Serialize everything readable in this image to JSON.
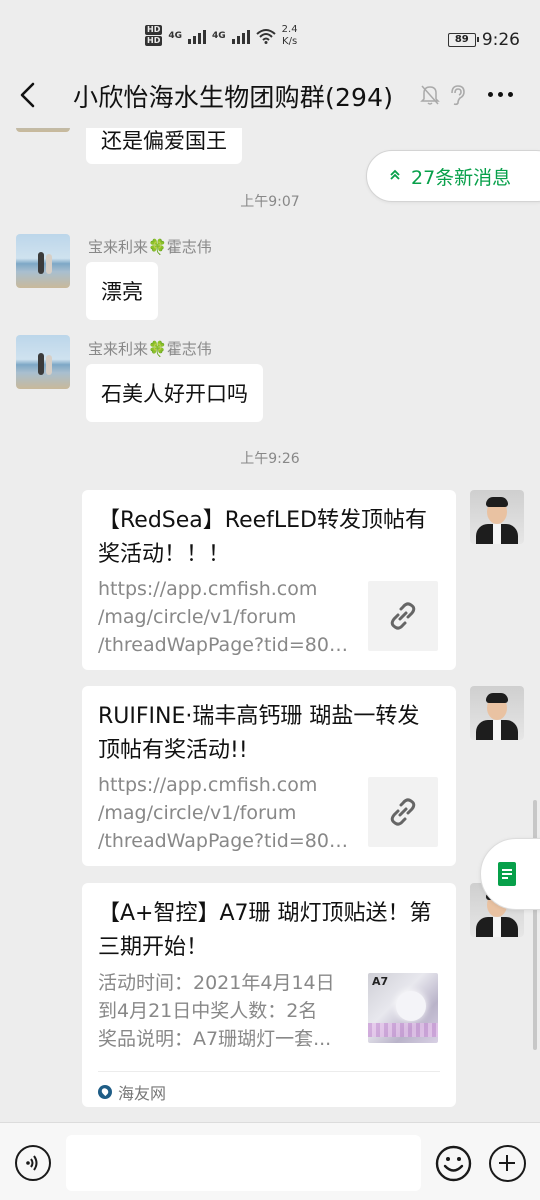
{
  "status_bar": {
    "hd_1": "HD",
    "hd_2": "HD",
    "net_1": "4G",
    "net_2": "4G",
    "speed_value": "2.4",
    "speed_unit": "K/s",
    "battery": "89",
    "time": "9:26"
  },
  "header": {
    "back_icon": "chevron-left-icon",
    "title": "小欣怡海水生物团购群(294)",
    "mute_icon": "bell-off-icon",
    "ear_icon": "ear-icon",
    "more_icon": "more-dots-icon"
  },
  "new_messages": {
    "label": "27条新消息",
    "icon": "double-chevron-up-icon"
  },
  "messages": {
    "partial": {
      "text": "还是偏爱国王"
    },
    "time_1": "上午9:07",
    "msg_1": {
      "sender_name": "宝来利来",
      "sender_emoji": "🍀",
      "sender_suffix": "霍志伟",
      "text": "漂亮"
    },
    "msg_2": {
      "sender_name": "宝来利来",
      "sender_emoji": "🍀",
      "sender_suffix": "霍志伟",
      "text": "石美人好开口吗"
    },
    "time_2": "上午9:26",
    "card_1": {
      "title": "【RedSea】ReefLED转发顶帖有奖活动！！！",
      "desc": [
        "https://app.cmfish.com",
        "/mag/circle/v1/forum",
        "/threadWapPage?tid=800..."
      ],
      "thumb_icon": "link-icon"
    },
    "card_2": {
      "title": "RUIFINE·瑞丰高钙珊 瑚盐一转发顶帖有奖活动!!",
      "desc": [
        "https://app.cmfish.com",
        "/mag/circle/v1/forum",
        "/threadWapPage?tid=803..."
      ],
      "thumb_icon": "link-icon"
    },
    "card_3": {
      "title": "【A+智控】A7珊 瑚灯顶贴送！第三期开始！",
      "desc": [
        "活动时间：2021年4月14日",
        "到4月21日中奖人数：2名",
        "奖品说明：A7珊瑚灯一套..."
      ],
      "thumb_text": "A7",
      "source": "海友网"
    }
  },
  "input_bar": {
    "voice_icon": "voice-icon",
    "emoji_icon": "emoji-icon",
    "plus_icon": "plus-circle-icon",
    "placeholder": ""
  },
  "float_button": {
    "icon": "file-icon"
  },
  "colors": {
    "accent_green": "#07a04a",
    "background": "#ededed",
    "bubble": "#ffffff",
    "meta_text": "#888888"
  }
}
